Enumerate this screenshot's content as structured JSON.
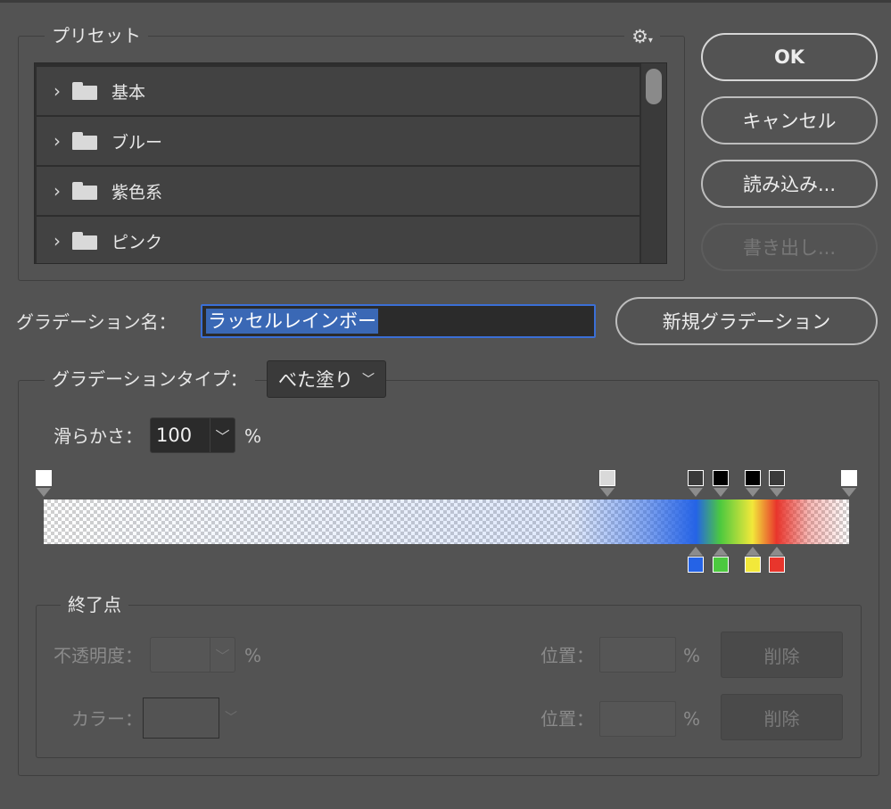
{
  "preset": {
    "legend": "プリセット",
    "items": [
      {
        "label": "基本"
      },
      {
        "label": "ブルー"
      },
      {
        "label": "紫色系"
      },
      {
        "label": "ピンク"
      }
    ]
  },
  "buttons": {
    "ok": "OK",
    "cancel": "キャンセル",
    "load": "読み込み...",
    "export": "書き出し...",
    "new_gradient": "新規グラデーション"
  },
  "gradient_name": {
    "label": "グラデーション名：",
    "value": "ラッセルレインボー"
  },
  "gradient_type": {
    "legend": "グラデーションタイプ：",
    "value": "べた塗り"
  },
  "smoothness": {
    "label": "滑らかさ：",
    "value": "100",
    "unit": "%"
  },
  "stops_panel": {
    "legend": "終了点",
    "opacity_label": "不透明度：",
    "opacity_unit": "%",
    "color_label": "カラー：",
    "location_label": "位置：",
    "location_unit": "%",
    "delete_label": "削除"
  },
  "gradient": {
    "opacity_stops": [
      {
        "location": 0,
        "color": "#ffffff"
      },
      {
        "location": 70,
        "color": "#d9d9d9"
      },
      {
        "location": 81,
        "color": "#3a3a3a"
      },
      {
        "location": 84,
        "color": "#000000"
      },
      {
        "location": 88,
        "color": "#000000"
      },
      {
        "location": 91,
        "color": "#3a3a3a"
      },
      {
        "location": 100,
        "color": "#ffffff"
      }
    ],
    "color_stops": [
      {
        "location": 81,
        "color": "#2563e6"
      },
      {
        "location": 84,
        "color": "#4cc93f"
      },
      {
        "location": 88,
        "color": "#f2e83a"
      },
      {
        "location": 91,
        "color": "#e8352c"
      }
    ]
  },
  "icons": {
    "chevron_right": "›",
    "chevron_down": "⌄",
    "gear": "⚙"
  }
}
